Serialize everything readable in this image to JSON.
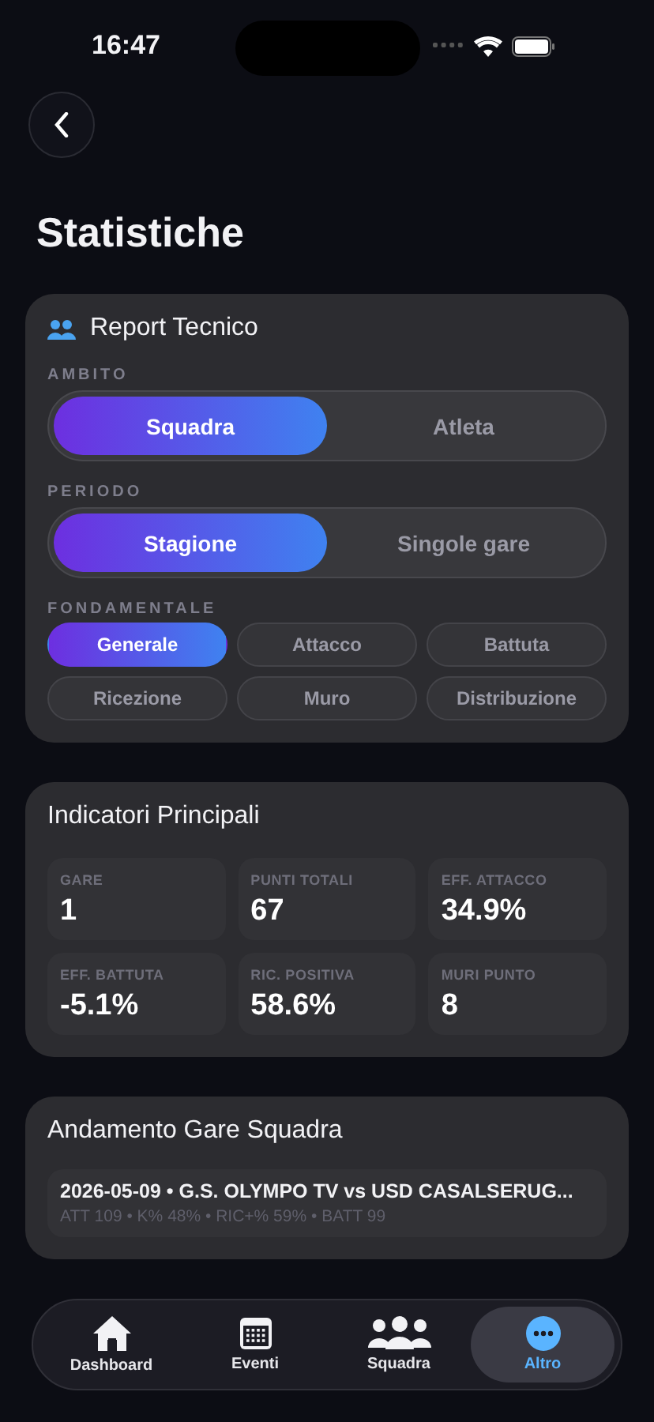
{
  "status_bar": {
    "time": "16:47"
  },
  "title": "Statistiche",
  "report": {
    "title": "Report Tecnico",
    "groups": [
      {
        "label": "AMBITO",
        "kind": "segmented",
        "options": [
          {
            "label": "Squadra",
            "selected": true
          },
          {
            "label": "Atleta",
            "selected": false
          }
        ]
      },
      {
        "label": "PERIODO",
        "kind": "segmented",
        "options": [
          {
            "label": "Stagione",
            "selected": true
          },
          {
            "label": "Singole gare",
            "selected": false
          }
        ]
      },
      {
        "label": "FONDAMENTALE",
        "kind": "chips",
        "options": [
          {
            "label": "Generale",
            "selected": true
          },
          {
            "label": "Attacco",
            "selected": false
          },
          {
            "label": "Battuta",
            "selected": false
          },
          {
            "label": "Ricezione",
            "selected": false
          },
          {
            "label": "Muro",
            "selected": false
          },
          {
            "label": "Distribuzione",
            "selected": false
          }
        ]
      }
    ]
  },
  "indicators": {
    "title": "Indicatori Principali",
    "items": [
      {
        "label": "GARE",
        "value": "1"
      },
      {
        "label": "PUNTI TOTALI",
        "value": "67"
      },
      {
        "label": "EFF. ATTACCO",
        "value": "34.9%"
      },
      {
        "label": "EFF. BATTUTA",
        "value": "-5.1%"
      },
      {
        "label": "RIC. POSITIVA",
        "value": "58.6%"
      },
      {
        "label": "MURI PUNTO",
        "value": "8"
      }
    ]
  },
  "trend": {
    "title": "Andamento Gare Squadra",
    "matches": [
      {
        "title": "2026-05-09 • G.S. OLYMPO TV vs USD CASALSERUG...",
        "stats": "ATT 109 • K% 48% • RIC+% 59% • BATT 99"
      }
    ]
  },
  "tab_bar": [
    {
      "label": "Dashboard",
      "kind": "home",
      "selected": false
    },
    {
      "label": "Eventi",
      "kind": "calendar",
      "selected": false
    },
    {
      "label": "Squadra",
      "kind": "team",
      "selected": false
    },
    {
      "label": "Altro",
      "kind": "more",
      "selected": true
    }
  ]
}
